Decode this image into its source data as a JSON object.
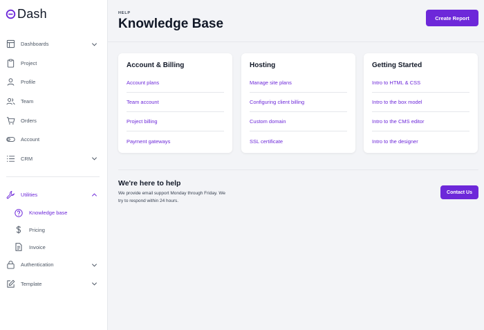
{
  "app": {
    "logo_text": "Dash"
  },
  "sidebar": {
    "items": [
      {
        "label": "Dashboards",
        "icon": "layout-icon",
        "has_chevron": true
      },
      {
        "label": "Project",
        "icon": "clipboard-icon",
        "has_chevron": false
      },
      {
        "label": "Profile",
        "icon": "user-icon",
        "has_chevron": false
      },
      {
        "label": "Team",
        "icon": "users-icon",
        "has_chevron": false
      },
      {
        "label": "Orders",
        "icon": "cart-icon",
        "has_chevron": false
      },
      {
        "label": "Account",
        "icon": "toggle-icon",
        "has_chevron": false
      },
      {
        "label": "CRM",
        "icon": "list-icon",
        "has_chevron": true
      }
    ],
    "utilities": {
      "label": "Utilities",
      "icon": "wrench-icon",
      "expanded": true,
      "children": [
        {
          "label": "Knowledge base",
          "icon": "help-circle-icon",
          "active": true
        },
        {
          "label": "Pricing",
          "icon": "dollar-icon",
          "active": false
        },
        {
          "label": "Invoice",
          "icon": "file-text-icon",
          "active": false
        }
      ]
    },
    "bottom_items": [
      {
        "label": "Authentication",
        "icon": "lock-icon",
        "has_chevron": true
      },
      {
        "label": "Template",
        "icon": "edit-icon",
        "has_chevron": true
      }
    ]
  },
  "header": {
    "eyebrow": "HELP",
    "title": "Knowledge Base",
    "create_report_label": "Create Report"
  },
  "cards": [
    {
      "title": "Account & Billing",
      "links": [
        "Account plans",
        "Team account",
        "Project billing",
        "Payment gateways"
      ]
    },
    {
      "title": "Hosting",
      "links": [
        "Manage site plans",
        "Configuring client billing",
        "Custom domain",
        "SSL certificate"
      ]
    },
    {
      "title": "Getting Started",
      "links": [
        "Intro to HTML & CSS",
        "Intro to the box model",
        "Intro to the CMS editor",
        "Intro to the designer"
      ]
    }
  ],
  "help": {
    "title": "We're here to help",
    "text": "We provide email support Monday through Friday. We try to respond within 24 hours.",
    "contact_label": "Contact Us"
  },
  "colors": {
    "accent": "#6d28d9",
    "background": "#f3f4f7",
    "sidebar_bg": "#ffffff"
  }
}
